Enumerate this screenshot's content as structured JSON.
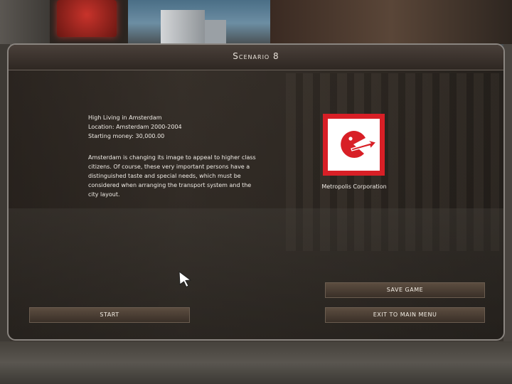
{
  "dialog": {
    "title": "Scenario 8"
  },
  "scenario": {
    "name": "High Living in Amsterdam",
    "location": "Location: Amsterdam 2000-2004",
    "money": "Starting money: 30,000.00",
    "description": "Amsterdam is changing its image to appeal to higher class citizens. Of course, these very important persons have a distinguished taste and special needs, which must be considered when arranging the transport system and the city layout."
  },
  "company": {
    "name": "Metropolis Corporation",
    "logo_icon": "pacman-arrow-logo-icon",
    "logo_colors": {
      "frame": "#d81f26",
      "inner": "#ffffff",
      "mark": "#d81f26"
    }
  },
  "buttons": {
    "save": "SAVE GAME",
    "exit": "EXIT TO MAIN MENU",
    "start": "START"
  },
  "icons": {
    "cursor": "mouse-pointer-icon"
  }
}
